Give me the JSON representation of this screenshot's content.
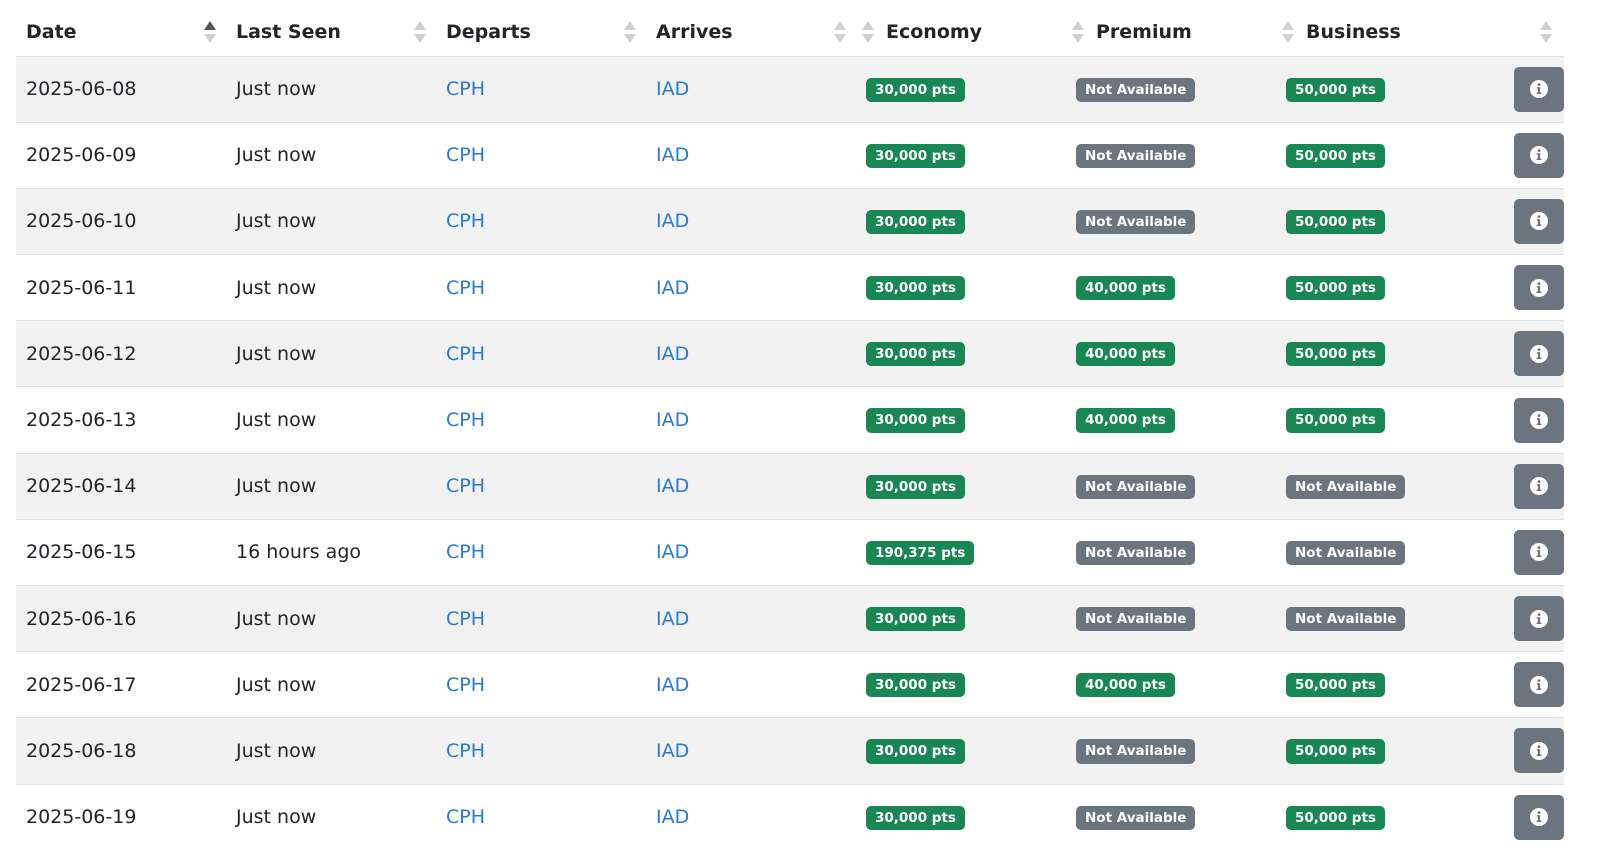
{
  "columns": [
    {
      "label": "Date",
      "sort": "asc"
    },
    {
      "label": "Last Seen",
      "sort": "none"
    },
    {
      "label": "Departs",
      "sort": "none"
    },
    {
      "label": "Arrives",
      "sort": "none"
    },
    {
      "label": "Economy",
      "sort": "none"
    },
    {
      "label": "Premium",
      "sort": "none"
    },
    {
      "label": "Business",
      "sort": "none"
    },
    {
      "label": "",
      "sort": "none"
    }
  ],
  "colors": {
    "available": "#198754",
    "unavailable": "#6c757d",
    "link": "#2a7ad5"
  },
  "action_icon": "info-icon",
  "rows": [
    {
      "date": "2025-06-08",
      "last_seen": "Just now",
      "departs": "CPH",
      "arrives": "IAD",
      "economy": "30,000 pts",
      "premium": "Not Available",
      "business": "50,000 pts"
    },
    {
      "date": "2025-06-09",
      "last_seen": "Just now",
      "departs": "CPH",
      "arrives": "IAD",
      "economy": "30,000 pts",
      "premium": "Not Available",
      "business": "50,000 pts"
    },
    {
      "date": "2025-06-10",
      "last_seen": "Just now",
      "departs": "CPH",
      "arrives": "IAD",
      "economy": "30,000 pts",
      "premium": "Not Available",
      "business": "50,000 pts"
    },
    {
      "date": "2025-06-11",
      "last_seen": "Just now",
      "departs": "CPH",
      "arrives": "IAD",
      "economy": "30,000 pts",
      "premium": "40,000 pts",
      "business": "50,000 pts"
    },
    {
      "date": "2025-06-12",
      "last_seen": "Just now",
      "departs": "CPH",
      "arrives": "IAD",
      "economy": "30,000 pts",
      "premium": "40,000 pts",
      "business": "50,000 pts"
    },
    {
      "date": "2025-06-13",
      "last_seen": "Just now",
      "departs": "CPH",
      "arrives": "IAD",
      "economy": "30,000 pts",
      "premium": "40,000 pts",
      "business": "50,000 pts"
    },
    {
      "date": "2025-06-14",
      "last_seen": "Just now",
      "departs": "CPH",
      "arrives": "IAD",
      "economy": "30,000 pts",
      "premium": "Not Available",
      "business": "Not Available"
    },
    {
      "date": "2025-06-15",
      "last_seen": "16 hours ago",
      "departs": "CPH",
      "arrives": "IAD",
      "economy": "190,375 pts",
      "premium": "Not Available",
      "business": "Not Available"
    },
    {
      "date": "2025-06-16",
      "last_seen": "Just now",
      "departs": "CPH",
      "arrives": "IAD",
      "economy": "30,000 pts",
      "premium": "Not Available",
      "business": "Not Available"
    },
    {
      "date": "2025-06-17",
      "last_seen": "Just now",
      "departs": "CPH",
      "arrives": "IAD",
      "economy": "30,000 pts",
      "premium": "40,000 pts",
      "business": "50,000 pts"
    },
    {
      "date": "2025-06-18",
      "last_seen": "Just now",
      "departs": "CPH",
      "arrives": "IAD",
      "economy": "30,000 pts",
      "premium": "Not Available",
      "business": "50,000 pts"
    },
    {
      "date": "2025-06-19",
      "last_seen": "Just now",
      "departs": "CPH",
      "arrives": "IAD",
      "economy": "30,000 pts",
      "premium": "Not Available",
      "business": "50,000 pts"
    }
  ]
}
